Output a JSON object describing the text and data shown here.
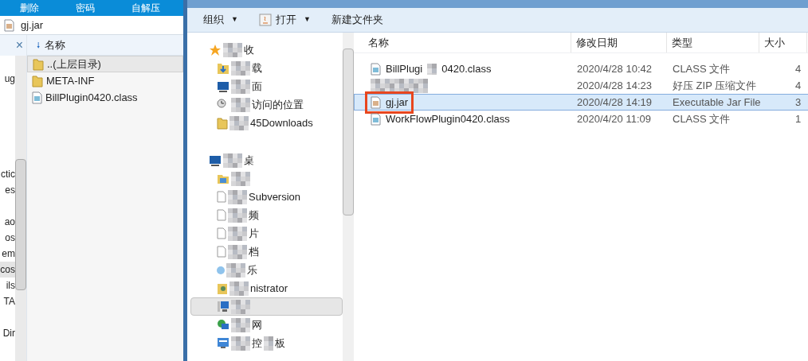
{
  "archiver": {
    "toolbar": [
      "删除",
      "密码",
      "自解压"
    ],
    "address": "gj.jar",
    "tree_fragments": [
      {
        "text": "ug",
        "selected": false
      },
      {
        "text": "ctic",
        "selected": false
      },
      {
        "text": "es",
        "selected": false
      },
      {
        "text": "ao",
        "selected": false
      },
      {
        "text": "os",
        "selected": false
      },
      {
        "text": "em",
        "selected": false
      },
      {
        "text": "cos",
        "selected": true
      },
      {
        "text": "ils",
        "selected": false
      },
      {
        "text": "TA",
        "selected": false
      },
      {
        "text": "Dir",
        "selected": false
      }
    ],
    "close": "×",
    "sort_glyph": "🠗",
    "column": "名称",
    "items": [
      {
        "name": "..(上层目录)",
        "kind": "folder",
        "selected": true
      },
      {
        "name": "META-INF",
        "kind": "folder",
        "selected": false
      },
      {
        "name": "BillPlugin0420.class",
        "kind": "file",
        "selected": false
      }
    ]
  },
  "explorer": {
    "toolbar": [
      {
        "label": "组织",
        "kind": "menu",
        "caret": "▼"
      },
      {
        "label": "打开",
        "kind": "open",
        "caret": "▼"
      },
      {
        "label": "新建文件夹",
        "kind": "plain"
      }
    ],
    "nav": [
      {
        "text": "收",
        "kind": "star",
        "selected": false,
        "children": [
          {
            "text": "载",
            "kind": "download",
            "selected": false
          },
          {
            "text": "面",
            "kind": "desktop",
            "selected": false
          },
          {
            "text": "访问的位置",
            "kind": "recent",
            "selected": false
          },
          {
            "text": "45Downloads",
            "kind": "folder",
            "selected": false
          }
        ]
      },
      {
        "text": "桌",
        "kind": "desktop",
        "selected": false,
        "children": [
          {
            "kind": "library",
            "selected": false
          },
          {
            "text": "Subversion",
            "kind": "doc",
            "selected": false
          },
          {
            "text": "频",
            "kind": "doc",
            "selected": false
          },
          {
            "text": "片",
            "kind": "doc",
            "selected": false
          },
          {
            "text": "档",
            "kind": "doc",
            "selected": false
          },
          {
            "text": "乐",
            "kind": "music",
            "selected": false
          },
          {
            "text": "nistrator",
            "kind": "user",
            "selected": false
          },
          {
            "kind": "computer",
            "selected": true
          },
          {
            "text": "网",
            "kind": "network",
            "selected": false
          },
          {
            "text": "控",
            "text_tail": "板",
            "kind": "panel",
            "selected": false
          }
        ]
      }
    ],
    "columns": [
      "名称",
      "修改日期",
      "类型",
      "大小"
    ],
    "rows": [
      {
        "name": "BillPlugi",
        "name_tail": "0420.class",
        "kind": "class",
        "date": "2020/4/28 10:42",
        "type": "CLASS 文件",
        "size": "4",
        "selected": false,
        "highlighted": false
      },
      {
        "kind": "blurred",
        "date": "2020/4/28 14:23",
        "type": "好压 ZIP 压缩文件",
        "size": "4",
        "selected": false,
        "highlighted": false
      },
      {
        "name": "gj.jar",
        "kind": "jar",
        "date": "2020/4/28 14:19",
        "type": "Executable Jar File",
        "size": "3",
        "selected": true,
        "highlighted": true
      },
      {
        "name": "WorkFlowPlugin0420.class",
        "kind": "class",
        "date": "2020/4/20 11:09",
        "type": "CLASS 文件",
        "size": "1",
        "selected": false,
        "highlighted": false
      }
    ]
  }
}
